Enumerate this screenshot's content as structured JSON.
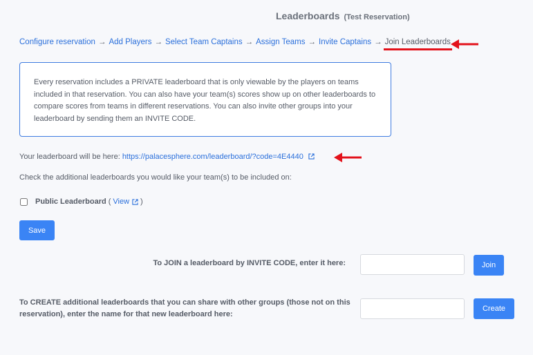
{
  "header": {
    "title": "Leaderboards",
    "subtitle": "(Test Reservation)"
  },
  "breadcrumb": {
    "steps": [
      "Configure reservation",
      "Add Players",
      "Select Team Captains",
      "Assign Teams",
      "Invite Captains"
    ],
    "separator": "→",
    "current": "Join Leaderboards"
  },
  "info": {
    "text": "Every reservation includes a PRIVATE leaderboard that is only viewable by the players on teams included in that reservation. You can also have your team(s) scores show up on other leaderboards to compare scores from teams in different reservations. You can also invite other groups into your leaderboard by sending them an INVITE CODE."
  },
  "leaderboard_link": {
    "label": "Your leaderboard will be here:",
    "url": "https://palacesphere.com/leaderboard/?code=4E4440"
  },
  "additional": {
    "prompt": "Check the additional leaderboards you would like your team(s) to be included on:",
    "public_label": "Public Leaderboard",
    "paren_open": "(",
    "view_label": "View",
    "paren_close": ")",
    "public_checked": false
  },
  "save_label": "Save",
  "join": {
    "label": "To JOIN a leaderboard by INVITE CODE, enter it here:",
    "value": "",
    "button": "Join"
  },
  "create": {
    "label": "To CREATE additional leaderboards that you can share with other groups (those not on this reservation), enter the name for that new leaderboard here:",
    "value": "",
    "button": "Create"
  },
  "colors": {
    "link": "#2a6fdb",
    "button": "#3a84f5",
    "annotation_red": "#e3121b",
    "info_border": "#3e7be0"
  },
  "icons": {
    "external_link": "external-link-icon",
    "annotation": "red-arrow-icon"
  }
}
